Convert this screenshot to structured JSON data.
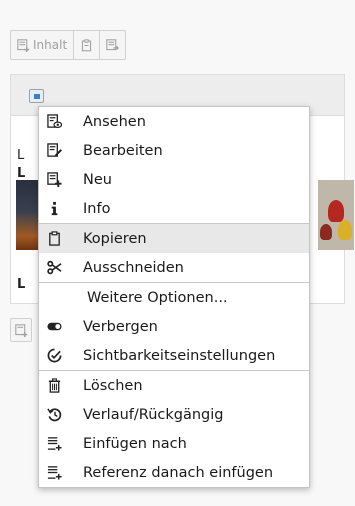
{
  "toolbar": {
    "content_label": "Inhalt"
  },
  "background": {
    "frag_l1": "L",
    "frag_l2": "L",
    "frag_l3": "L"
  },
  "menu": {
    "items": [
      {
        "label": "Ansehen",
        "icon": "view-icon"
      },
      {
        "label": "Bearbeiten",
        "icon": "edit-icon"
      },
      {
        "label": "Neu",
        "icon": "new-icon"
      },
      {
        "label": "Info",
        "icon": "info-icon"
      },
      {
        "label": "Kopieren",
        "icon": "clipboard-icon"
      },
      {
        "label": "Ausschneiden",
        "icon": "scissors-icon"
      },
      {
        "label": "Weitere Optionen..."
      },
      {
        "label": "Verbergen",
        "icon": "toggle-icon"
      },
      {
        "label": "Sichtbarkeitseinstellungen",
        "icon": "visibility-settings-icon"
      },
      {
        "label": "Löschen",
        "icon": "trash-icon"
      },
      {
        "label": "Verlauf/Rückgängig",
        "icon": "history-icon"
      },
      {
        "label": "Einfügen nach",
        "icon": "paste-after-icon"
      },
      {
        "label": "Referenz danach einfügen",
        "icon": "paste-reference-icon"
      }
    ]
  }
}
